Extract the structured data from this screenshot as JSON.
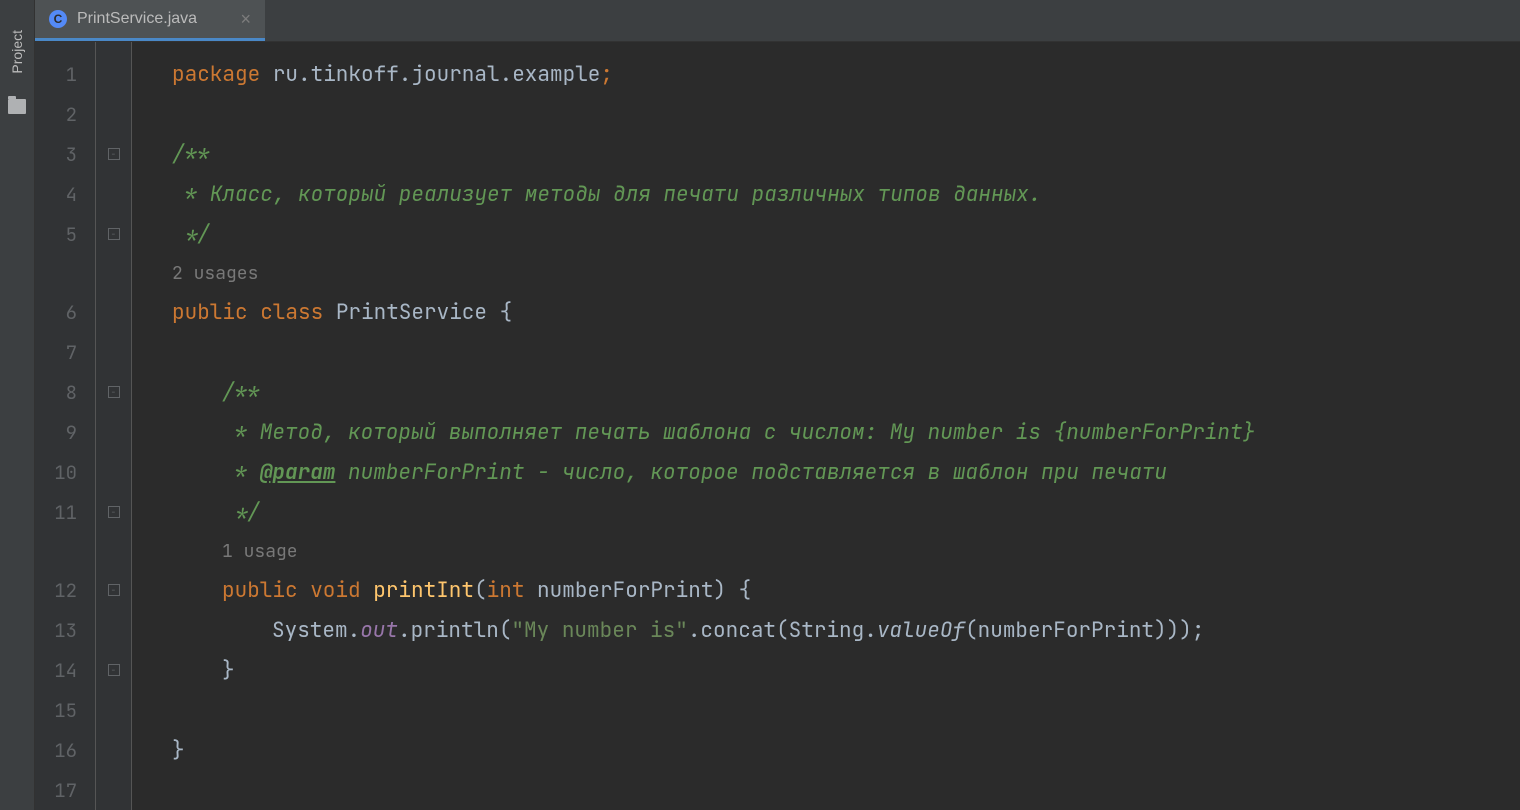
{
  "sidebar": {
    "label": "Project"
  },
  "tab": {
    "icon_letter": "C",
    "filename": "PrintService.java"
  },
  "code": {
    "line_numbers": [
      "1",
      "2",
      "3",
      "4",
      "5",
      "",
      "6",
      "7",
      "8",
      "9",
      "10",
      "11",
      "",
      "12",
      "13",
      "14",
      "15",
      "16",
      "17"
    ],
    "line1": {
      "kw_package": "package ",
      "pkg": "ru.tinkoff.journal.example",
      "semi": ";"
    },
    "line3": {
      "text": "/**"
    },
    "line4": {
      "text": " * Класс, который реализует методы для печати различных типов данных."
    },
    "line5": {
      "text": " */"
    },
    "usage1": "2 usages",
    "line6": {
      "kw_public": "public ",
      "kw_class": "class ",
      "name": "PrintService ",
      "brace": "{"
    },
    "line8": {
      "text": "/**"
    },
    "line9": {
      "text": " * Метод, который выполняет печать шаблона с числом: My number is {numberForPrint}"
    },
    "line10": {
      "star": " * ",
      "tag": "@param",
      "rest": " numberForPrint - число, которое подставляется в шаблон при печати"
    },
    "line11": {
      "text": " */"
    },
    "usage2": "1 usage",
    "line12": {
      "kw_public": "public ",
      "kw_void": "void ",
      "method": "printInt",
      "paren_open": "(",
      "kw_int": "int ",
      "param": "numberForPrint",
      "paren_close": ") ",
      "brace": "{"
    },
    "line13": {
      "sys": "System.",
      "out": "out",
      "println": ".println(",
      "str": "\"My number is\"",
      "concat": ".concat(String.",
      "valueof": "valueOf",
      "rest": "(numberForPrint)));"
    },
    "line14": {
      "brace": "}"
    },
    "line16": {
      "brace": "}"
    }
  }
}
